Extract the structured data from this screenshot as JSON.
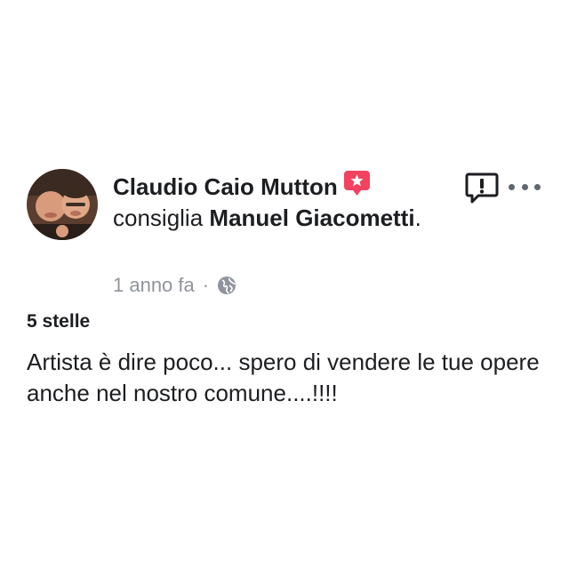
{
  "post": {
    "author_name": "Claudio Caio Mutton",
    "recommends_text": "consiglia",
    "page_name": "Manuel Giacometti",
    "period": ".",
    "timestamp": "1 anno fa",
    "separator": "·",
    "audience_icon": "globe-icon",
    "recommend_badge_icon": "recommend-star-badge-icon",
    "rating_text": "5 stelle",
    "review_text": "Artista è dire poco... spero di vendere le tue opere anche nel nostro comune....!!!!"
  },
  "actions": {
    "report_icon": "report-icon",
    "more_icon": "more-options-icon"
  },
  "colors": {
    "text_primary": "#1c1e21",
    "text_secondary": "#90949c",
    "badge_red": "#f3425f",
    "icon_dark": "#1c1e21"
  }
}
